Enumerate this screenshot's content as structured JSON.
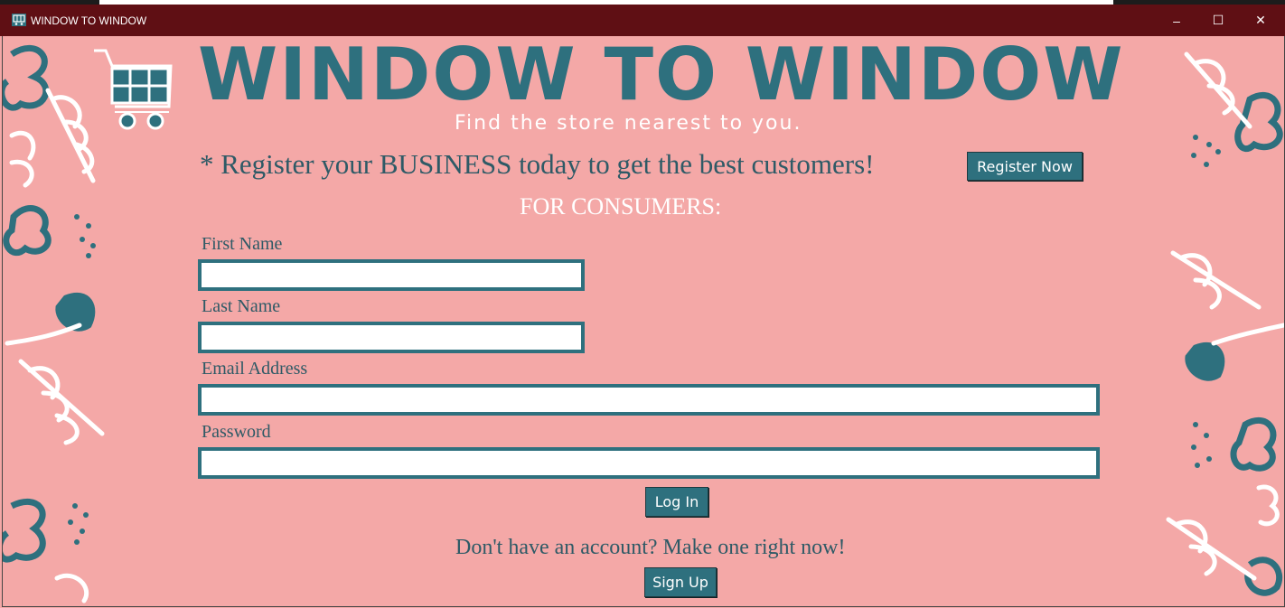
{
  "window": {
    "title": "WINDOW TO WINDOW",
    "controls": {
      "minimize": "–",
      "maximize": "☐",
      "close": "✕"
    }
  },
  "header": {
    "brand": "WINDOW TO WINDOW",
    "tagline": "Find the store nearest to you.",
    "logo_icon": "shopping-cart-icon"
  },
  "business": {
    "text": "* Register your BUSINESS today to get the best customers!",
    "button": "Register Now"
  },
  "consumers": {
    "heading": "FOR CONSUMERS:",
    "fields": {
      "first_name": {
        "label": "First Name",
        "value": ""
      },
      "last_name": {
        "label": "Last Name",
        "value": ""
      },
      "email": {
        "label": "Email Address",
        "value": ""
      },
      "password": {
        "label": "Password",
        "value": ""
      }
    },
    "login_button": "Log In",
    "signup_prompt": "Don't have an account? Make one right now!",
    "signup_button": "Sign Up"
  },
  "colors": {
    "background": "#f4a8a7",
    "titlebar": "#5f0f14",
    "accent": "#2e707e",
    "text": "#2e5a66"
  }
}
